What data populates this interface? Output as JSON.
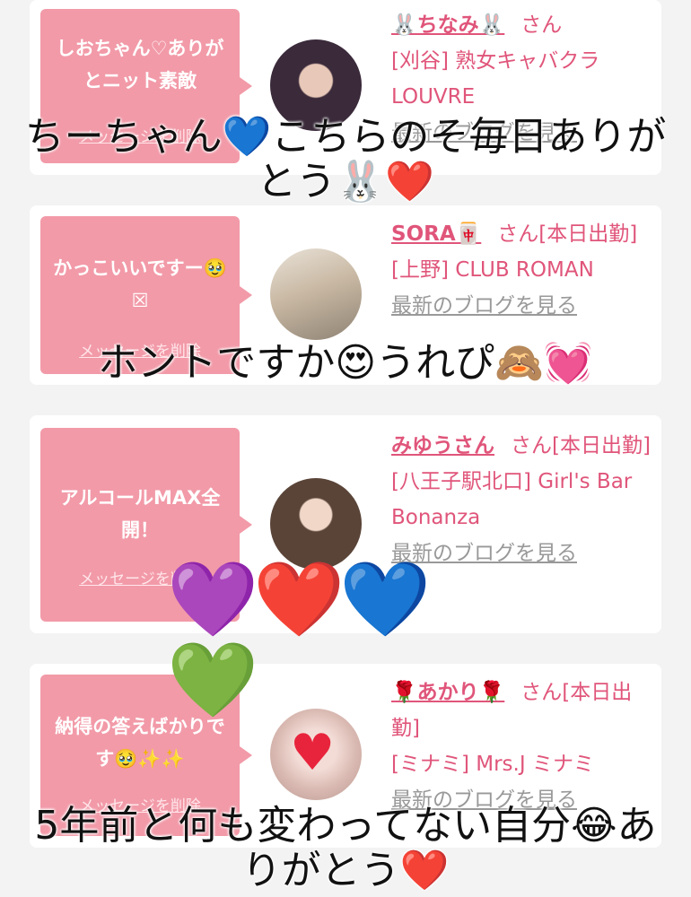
{
  "cards": [
    {
      "message": "しおちゃん♡ありがとニット素敵",
      "delete_label": "メッセージを削除",
      "name": "🐰ちなみ🐰",
      "honorific": "さん",
      "shop": "[刈谷] 熟女キャバクラLOUVRE",
      "blog_link": "最新のブログを見る"
    },
    {
      "message": "かっこいいですー🥹☒",
      "delete_label": "メッセージを削除",
      "name": "SORA🀄",
      "honorific": "さん[本日出勤]",
      "shop": "[上野] CLUB ROMAN",
      "blog_link": "最新のブログを見る"
    },
    {
      "message": "アルコールMAX全開！",
      "delete_label": "メッセージを削除",
      "name": "みゆうさん",
      "honorific": "さん[本日出勤]",
      "shop": "[八王子駅北口] Girl's Bar Bonanza",
      "blog_link": "最新のブログを見る"
    },
    {
      "message": "納得の答えばかりです🥹✨✨",
      "delete_label": "メッセージを削除",
      "name": "🌹あかり🌹",
      "honorific": "さん[本日出勤]",
      "shop": "[ミナミ] Mrs.J ミナミ",
      "blog_link": "最新のブログを見る"
    }
  ],
  "overlays": {
    "caption1": "ちーちゃん💙こちらのそ毎日ありがとう🐰❤️",
    "caption2": "ホントですか😍うれぴ🙈💓",
    "hearts": "💜❤️💙💚",
    "caption3": "5年前と何も変わってない自分😂ありがとう❤️"
  },
  "colors": {
    "bubble": "#f29aa8",
    "name": "#e0557a",
    "link_gray": "#999999"
  }
}
